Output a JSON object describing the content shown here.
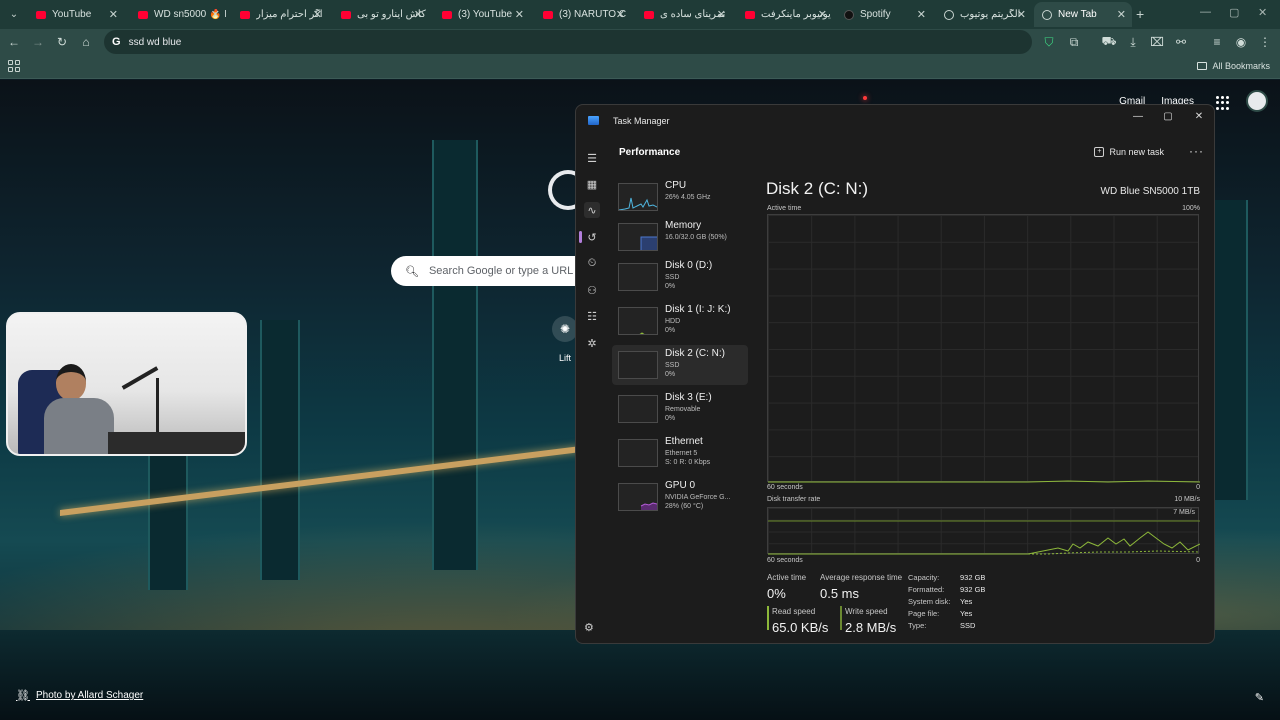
{
  "browser": {
    "tabs": [
      {
        "title": "YouTube",
        "favicon": "youtube-icon"
      },
      {
        "title": "WD sn5000 🔥 I",
        "favicon": "youtube-icon"
      },
      {
        "title": "اگر احترام میزار",
        "favicon": "youtube-icon"
      },
      {
        "title": "کاش اینارو تو بی",
        "favicon": "youtube-icon"
      },
      {
        "title": "(3) YouTube",
        "favicon": "youtube-icon"
      },
      {
        "title": "(3) NARUTO C",
        "favicon": "youtube-icon"
      },
      {
        "title": "تمرینای ساده ی",
        "favicon": "youtube-icon"
      },
      {
        "title": "یوتیوبر ماینکرفت",
        "favicon": "youtube-icon"
      },
      {
        "title": "Spotify",
        "favicon": "spotify-icon"
      },
      {
        "title": "الگریتم یوتیوب",
        "favicon": "openai-icon"
      },
      {
        "title": "New Tab",
        "favicon": "chrome-icon",
        "active": true
      }
    ],
    "omnibox_value": "ssd wd blue",
    "all_bookmarks_label": "All Bookmarks"
  },
  "ntp": {
    "gmail_label": "Gmail",
    "images_label": "Images",
    "search_placeholder": "Search Google or type a URL",
    "shortcut_label": "Lift",
    "photo_credit": "Photo by Allard Schager"
  },
  "task_manager": {
    "title": "Task Manager",
    "section_title": "Performance",
    "run_new_task_label": "Run new task",
    "devices": [
      {
        "name": "CPU",
        "sub1": "26% 4.05 GHz",
        "sub2": ""
      },
      {
        "name": "Memory",
        "sub1": "16.0/32.0 GB (50%)",
        "sub2": ""
      },
      {
        "name": "Disk 0 (D:)",
        "sub1": "SSD",
        "sub2": "0%"
      },
      {
        "name": "Disk 1 (I: J: K:)",
        "sub1": "HDD",
        "sub2": "0%"
      },
      {
        "name": "Disk 2 (C: N:)",
        "sub1": "SSD",
        "sub2": "0%",
        "selected": true
      },
      {
        "name": "Disk 3 (E:)",
        "sub1": "Removable",
        "sub2": "0%"
      },
      {
        "name": "Ethernet",
        "sub1": "Ethernet 5",
        "sub2": "S: 0 R: 0 Kbps"
      },
      {
        "name": "GPU 0",
        "sub1": "NVIDIA GeForce G...",
        "sub2": "28% (60 °C)"
      }
    ],
    "detail": {
      "title": "Disk 2 (C: N:)",
      "model": "WD Blue SN5000 1TB",
      "active_time_label": "Active time",
      "active_time_max": "100%",
      "seconds_label": "60 seconds",
      "zero_label": "0",
      "transfer_label": "Disk transfer rate",
      "transfer_max": "10 MB/s",
      "transfer_mark": "7 MB/s",
      "stats": {
        "active_time_label": "Active time",
        "active_time_value": "0%",
        "avg_response_label": "Average response time",
        "avg_response_value": "0.5 ms",
        "read_speed_label": "Read speed",
        "read_speed_value": "65.0 KB/s",
        "write_speed_label": "Write speed",
        "write_speed_value": "2.8 MB/s"
      },
      "properties": [
        {
          "key": "Capacity:",
          "value": "932 GB"
        },
        {
          "key": "Formatted:",
          "value": "932 GB"
        },
        {
          "key": "System disk:",
          "value": "Yes"
        },
        {
          "key": "Page file:",
          "value": "Yes"
        },
        {
          "key": "Type:",
          "value": "SSD"
        }
      ]
    }
  },
  "colors": {
    "accent_disk": "#8db83a",
    "cpu_line": "#4fb6e0",
    "memory_line": "#4c78d0",
    "gpu_fill": "#b35bd6",
    "read_bar": "#8db83a",
    "write_bar": "#8db83a"
  }
}
